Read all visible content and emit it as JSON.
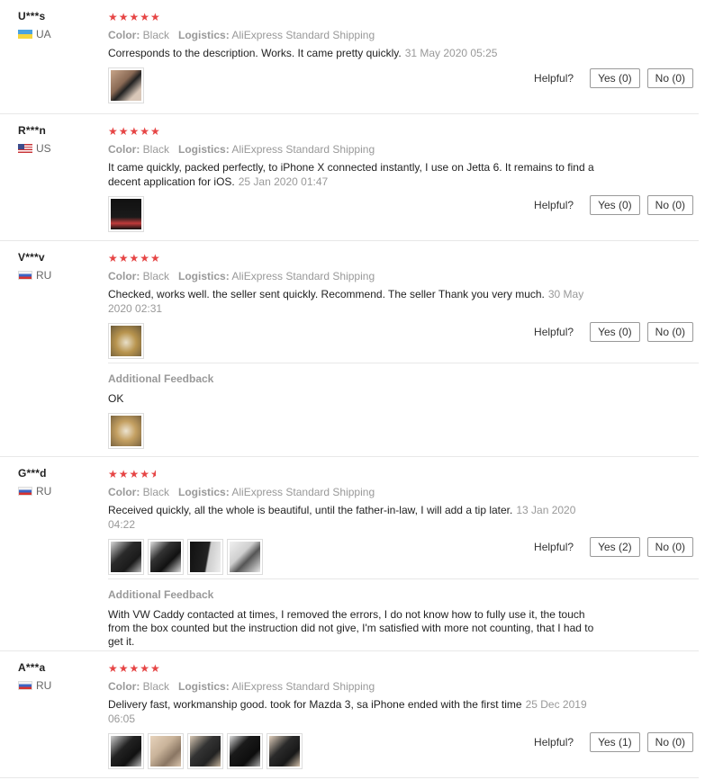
{
  "labels": {
    "color": "Color:",
    "logistics": "Logistics:",
    "helpful": "Helpful?",
    "additional_feedback": "Additional Feedback"
  },
  "colors": {
    "stars": "#e64545",
    "meta": "#999999"
  },
  "reviews": [
    {
      "user": "U***s",
      "country": "UA",
      "flag": "ua",
      "rating": 5,
      "stars": "★★★★★",
      "color": "Black",
      "logistics": "AliExpress Standard Shipping",
      "text": "Corresponds to the description. Works. It came pretty quickly.",
      "date": "31 May 2020 05:25",
      "yes": "Yes (0)",
      "no": "No (0)"
    },
    {
      "user": "R***n",
      "country": "US",
      "flag": "us",
      "rating": 5,
      "stars": "★★★★★",
      "color": "Black",
      "logistics": "AliExpress Standard Shipping",
      "text_line1": "It came quickly, packed perfectly, to iPhone X connected instantly, I use on Jetta 6. It remains to find a",
      "text_line2": "decent application for iOS.",
      "date": "25 Jan 2020 01:47",
      "yes": "Yes (0)",
      "no": "No (0)"
    },
    {
      "user": "V***v",
      "country": "RU",
      "flag": "ru",
      "rating": 5,
      "stars": "★★★★★",
      "color": "Black",
      "logistics": "AliExpress Standard Shipping",
      "text": "Checked, works well. the seller sent quickly. Recommend. The seller Thank you very much.",
      "date_line1": "30 May",
      "date_line2": "2020 02:31",
      "yes": "Yes (0)",
      "no": "No (0)",
      "additional_text": "OK"
    },
    {
      "user": "G***d",
      "country": "RU",
      "flag": "ru",
      "rating": 4.5,
      "stars": "★★★★",
      "color": "Black",
      "logistics": "AliExpress Standard Shipping",
      "text": "Received quickly, all the whole is beautiful, until the father-in-law, I will add a tip later.",
      "date_line1": "13 Jan 2020",
      "date_line2": "04:22",
      "yes": "Yes (2)",
      "no": "No (0)",
      "additional_text": "With VW Caddy contacted at times, I removed the errors, I do not know how to fully use it, the touch from the box counted but the instruction did not give, I'm satisfied with more not counting, that I had to get it."
    },
    {
      "user": "A***a",
      "country": "RU",
      "flag": "ru",
      "rating": 5,
      "stars": "★★★★★",
      "color": "Black",
      "logistics": "AliExpress Standard Shipping",
      "text": "Delivery fast, workmanship good. took for Mazda 3, sa iPhone ended with the first time",
      "date_line1": "25 Dec 2019",
      "date_line2": "06:05",
      "yes": "Yes (1)",
      "no": "No (0)"
    }
  ]
}
